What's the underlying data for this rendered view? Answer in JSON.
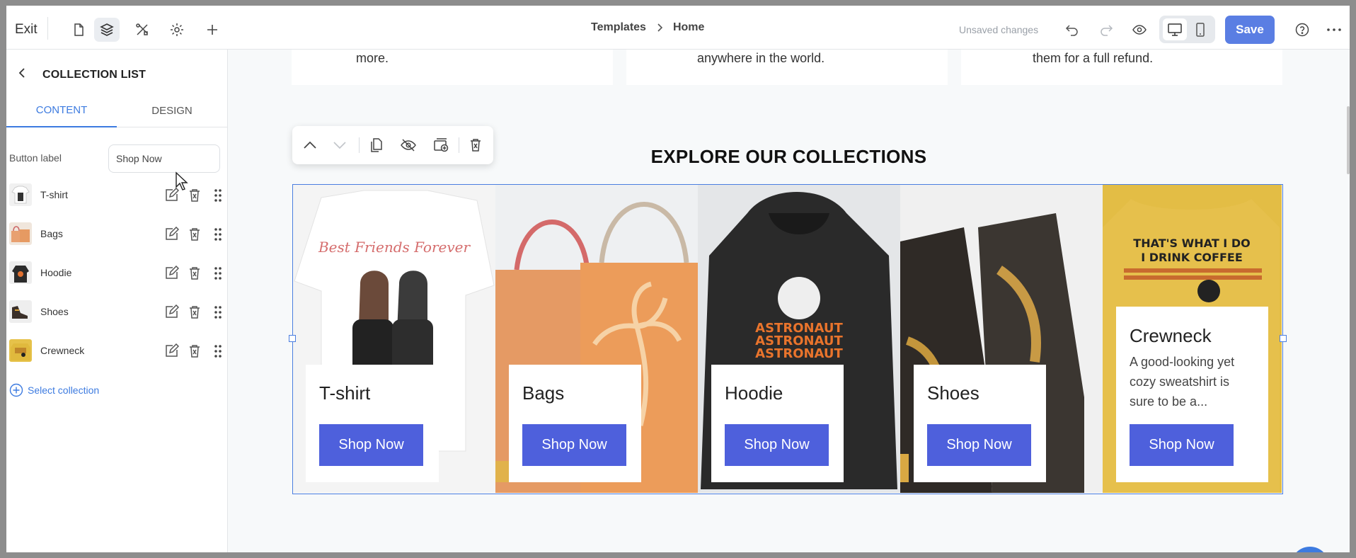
{
  "topbar": {
    "exit_label": "Exit",
    "breadcrumb": [
      "Templates",
      "Home"
    ],
    "unsaved": "Unsaved changes",
    "save_label": "Save",
    "accent": "#5a7ee3"
  },
  "sidebar": {
    "title": "COLLECTION LIST",
    "tabs": [
      "CONTENT",
      "DESIGN"
    ],
    "active_tab": "CONTENT",
    "button_label_field": {
      "label": "Button label",
      "value": "Shop Now"
    },
    "collections": [
      {
        "label": "T-shirt"
      },
      {
        "label": "Bags"
      },
      {
        "label": "Hoodie"
      },
      {
        "label": "Shoes"
      },
      {
        "label": "Crewneck"
      }
    ],
    "select_collection": "Select collection"
  },
  "canvas": {
    "features": [
      "more.",
      "anywhere in the world.",
      "them for a full refund."
    ],
    "heading": "EXPLORE OUR COLLECTIONS",
    "cards": [
      {
        "title": "T-shirt",
        "button": "Shop Now"
      },
      {
        "title": "Bags",
        "button": "Shop Now"
      },
      {
        "title": "Hoodie",
        "button": "Shop Now"
      },
      {
        "title": "Shoes",
        "button": "Shop Now"
      },
      {
        "title": "Crewneck",
        "description": "A good-looking yet cozy sweatshirt is sure to be a...",
        "button": "Shop Now"
      }
    ],
    "button_color": "#4e60dc"
  }
}
